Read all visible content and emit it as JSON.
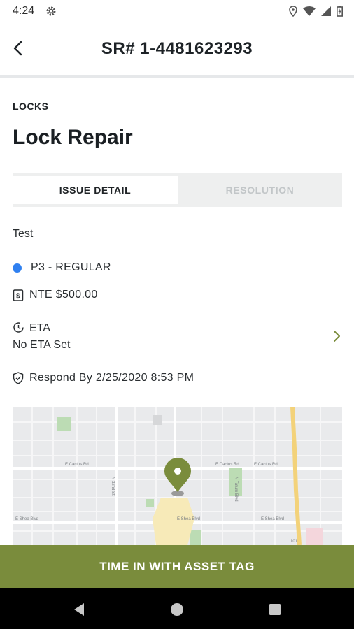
{
  "status_bar": {
    "time": "4:24"
  },
  "header": {
    "title": "SR# 1-4481623293"
  },
  "request": {
    "category": "LOCKS",
    "title": "Lock Repair",
    "description": "Test",
    "priority": "P3 - REGULAR",
    "priority_color": "#2f80f0",
    "nte": "NTE $500.00",
    "eta_label": "ETA",
    "eta_value": "No ETA Set",
    "respond_by": "Respond By 2/25/2020 8:53 PM"
  },
  "tabs": [
    {
      "label": "ISSUE DETAIL",
      "active": true
    },
    {
      "label": "RESOLUTION",
      "active": false
    }
  ],
  "map": {
    "streets": [
      "E Cactus Rd",
      "E Cactus Rd",
      "E Cactus Rd",
      "E Shea Blvd",
      "E Shea Blvd",
      "E Shea Blvd",
      "N 32nd St",
      "N Tatum Blvd",
      "101"
    ],
    "pin_color": "#7a8c3c"
  },
  "cta": {
    "label": "TIME IN WITH ASSET TAG",
    "color": "#7a8c3c"
  },
  "icons": [
    "gear-icon",
    "location-icon",
    "wifi-icon",
    "signal-icon",
    "battery-icon",
    "back-arrow-icon",
    "dollar-icon",
    "clock-icon",
    "shield-check-icon",
    "chevron-right-icon",
    "map-pin-icon",
    "nav-back-icon",
    "nav-home-icon",
    "nav-recents-icon"
  ]
}
